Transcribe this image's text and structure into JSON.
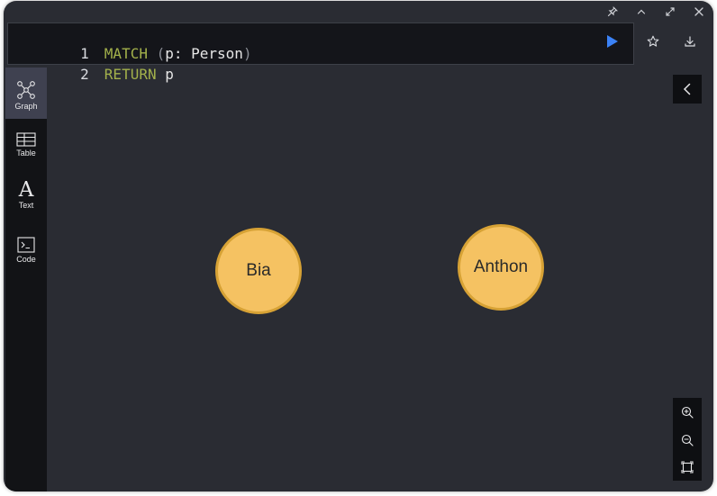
{
  "editor": {
    "lines": [
      {
        "number": "1",
        "tokens": [
          "MATCH",
          " (",
          "p: Person",
          ")"
        ]
      },
      {
        "number": "2",
        "tokens": [
          "RETURN",
          " p"
        ]
      }
    ]
  },
  "actions": {
    "run_icon": "play-icon",
    "favorite_icon": "star-icon",
    "download_icon": "download-icon",
    "run_color": "#3b82f6"
  },
  "window_controls": [
    "pin-icon",
    "chevron-up-icon",
    "expand-icon",
    "close-icon"
  ],
  "sidebar": {
    "items": [
      {
        "label": "Graph",
        "icon": "graph-icon",
        "active": true
      },
      {
        "label": "Table",
        "icon": "table-icon",
        "active": false
      },
      {
        "label": "A",
        "label_text": "Text",
        "icon": "text-icon",
        "active": false
      },
      {
        "label": "Code",
        "icon": "code-icon",
        "active": false
      }
    ]
  },
  "graph": {
    "nodes": [
      {
        "caption": "Bia",
        "label": "Person"
      },
      {
        "caption": "Anthon",
        "label": "Person"
      }
    ],
    "node_color": "#f5c262",
    "node_border_color": "#d7a235",
    "background_color": "#2a2c33"
  },
  "zoom_controls": [
    "zoom-in-icon",
    "zoom-out-icon",
    "fit-to-screen-icon"
  ]
}
